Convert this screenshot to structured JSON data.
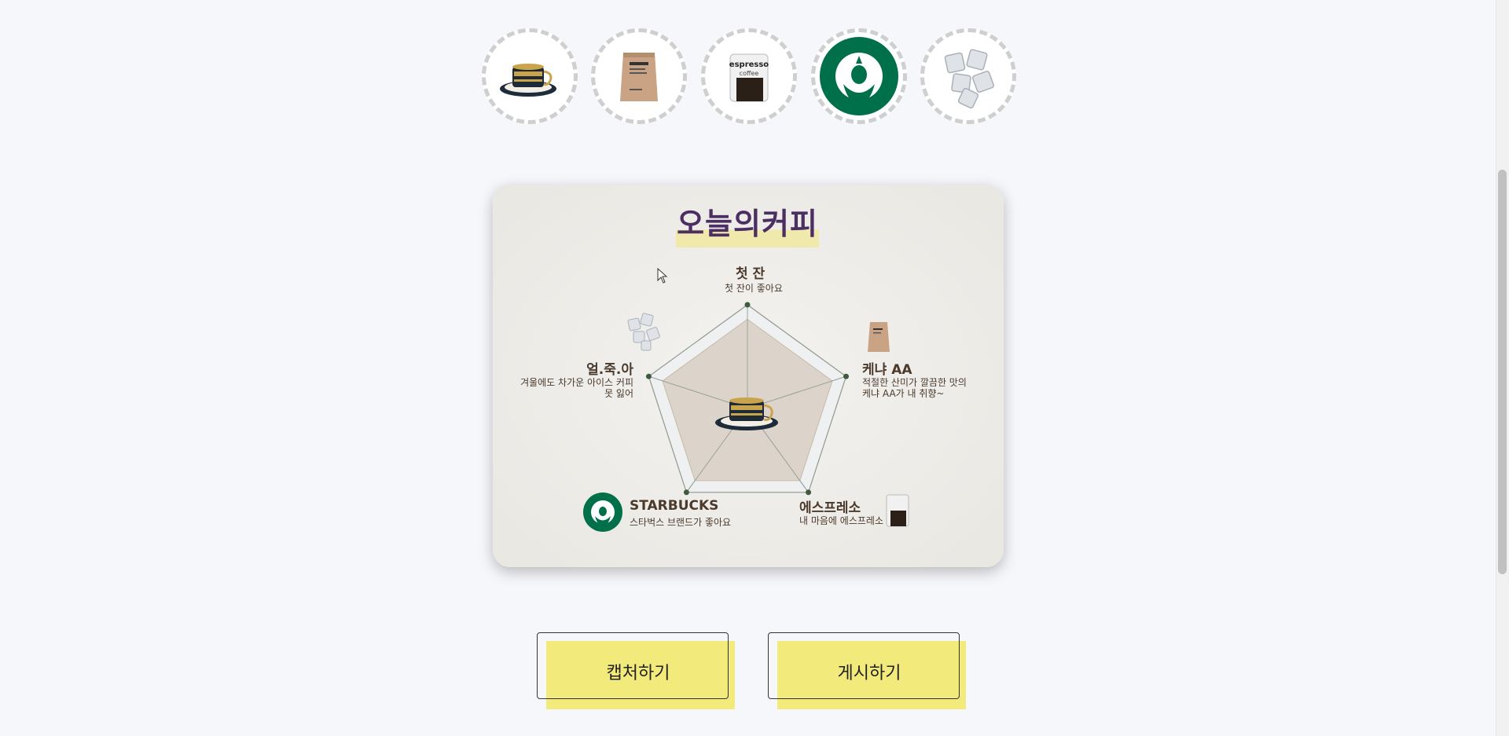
{
  "chart_title": "오늘의커피",
  "top_icons": [
    {
      "name": "coffee-cup-icon"
    },
    {
      "name": "coffee-bag-icon"
    },
    {
      "name": "espresso-jar-icon"
    },
    {
      "name": "starbucks-logo-icon"
    },
    {
      "name": "ice-cubes-icon"
    }
  ],
  "axes": [
    {
      "title": "첫 잔",
      "desc": "첫 잔이 좋아요"
    },
    {
      "title": "케냐 AA",
      "desc": "적절한 산미가 깔끔한 맛의 케냐 AA가 내 취향~"
    },
    {
      "title": "에스프레소",
      "desc": "내 마음에 에스프레소"
    },
    {
      "title": "STARBUCKS",
      "desc": "스타벅스 브랜드가 좋아요"
    },
    {
      "title": "얼.죽.아",
      "desc": "겨울에도 차가운 아이스 커피 못 잃어"
    }
  ],
  "axis_desc_lines": {
    "kenya_line1": "적절한 산미가 깔끔한 맛의",
    "kenya_line2": "케냐 AA가 내 취향~",
    "ice_line1": "겨울에도 차가운 아이스 커피",
    "ice_line2": "못 잃어"
  },
  "buttons": {
    "capture": "캡처하기",
    "post": "게시하기"
  },
  "colors": {
    "title_text": "#4b2f63",
    "title_highlight": "#efe9ab",
    "button_fill": "#f3ea7c",
    "radar_fill": "#d6cbbd",
    "starbucks_green": "#00704a"
  },
  "chart_data": {
    "type": "radar",
    "categories": [
      "첫 잔",
      "케냐 AA",
      "에스프레소",
      "STARBUCKS",
      "얼.죽.아"
    ],
    "values": [
      1,
      1,
      1,
      1,
      1
    ],
    "range": [
      0,
      1
    ]
  }
}
